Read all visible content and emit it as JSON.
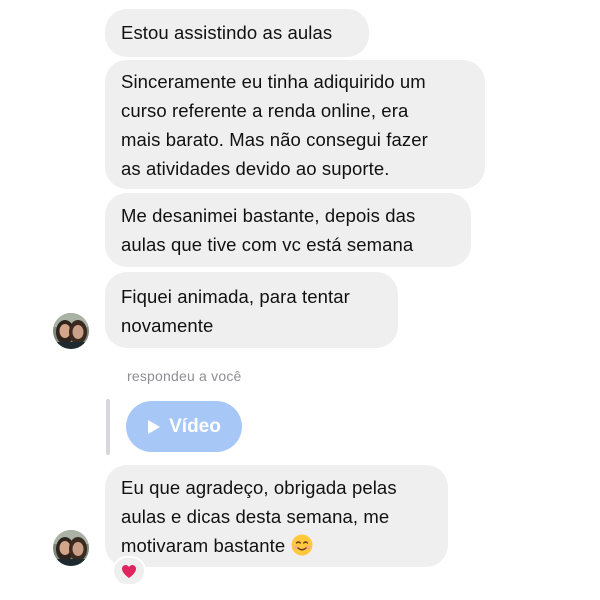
{
  "messages": [
    {
      "lines": [
        "Estou assistindo as aulas"
      ]
    },
    {
      "lines": [
        "Sinceramente eu tinha adiquirido um",
        "curso referente a renda online, era",
        "mais barato. Mas não consegui fazer",
        "as atividades devido ao suporte."
      ]
    },
    {
      "lines": [
        "Me desanimei bastante, depois das",
        "aulas que tive com vc está semana"
      ]
    },
    {
      "lines": [
        "Fiquei animada, para tentar",
        "novamente"
      ]
    }
  ],
  "reply": {
    "meta_text": "respondeu a você",
    "video_label": "Vídeo"
  },
  "last_message": {
    "lines": [
      "Eu que agradeço, obrigada pelas",
      "aulas e dicas desta semana, me",
      "motivaram bastante"
    ],
    "emoji": "smiling-face-emoji",
    "reaction": "red-heart-emoji"
  },
  "colors": {
    "bubble": "#efeff0",
    "meta_text": "#8e8e93",
    "video_button": "#a7c8f7",
    "heart": "#e0245e"
  }
}
